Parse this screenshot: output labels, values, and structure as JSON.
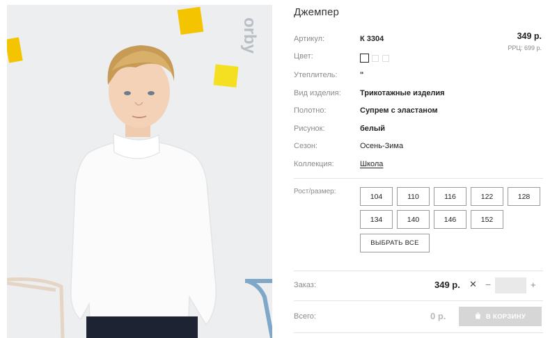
{
  "product": {
    "title": "Джемпер",
    "price": "349 р.",
    "rrp": "РРЦ: 699 р.",
    "photo_brand_mark": "orby"
  },
  "attributes": [
    {
      "label": "Артикул:",
      "value": "К 3304",
      "bold": true
    },
    {
      "label": "Цвет:",
      "value": "",
      "bold": false
    },
    {
      "label": "Утеплитель:",
      "value": "\"",
      "bold": false
    },
    {
      "label": "Вид изделия:",
      "value": "Трикотажные изделия",
      "bold": true
    },
    {
      "label": "Полотно:",
      "value": "Супрем с эластаном",
      "bold": true
    },
    {
      "label": "Рисунок:",
      "value": "белый",
      "bold": true
    },
    {
      "label": "Сезон:",
      "value": "Осень-Зима",
      "bold": false
    },
    {
      "label": "Коллекция:",
      "value": "Школа",
      "bold": false
    }
  ],
  "colors": [
    "#ffffff",
    "#ffffff",
    "#ffffff"
  ],
  "sizes": {
    "label": "Рост/размер:",
    "options": [
      "104",
      "110",
      "116",
      "122",
      "128",
      "134",
      "140",
      "146",
      "152"
    ],
    "select_all": "ВЫБРАТЬ ВСЕ"
  },
  "order": {
    "label": "Заказ:",
    "price": "349 р.",
    "remove": "✕",
    "minus": "−",
    "plus": "+",
    "quantity": ""
  },
  "total": {
    "label": "Всего:",
    "value": "0 р.",
    "cart_button": "В КОРЗИНУ"
  },
  "theme": {
    "accent_yellow": "#f5c800",
    "button_disabled": "#d6d6d6"
  }
}
